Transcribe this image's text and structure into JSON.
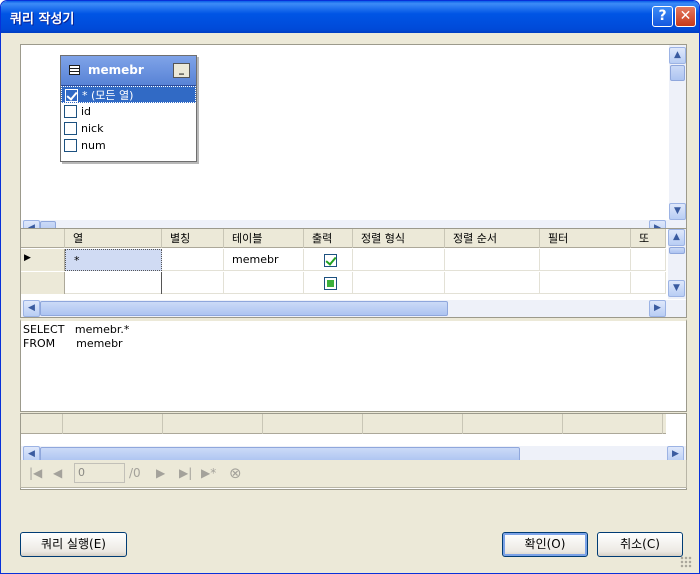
{
  "window": {
    "title": "쿼리 작성기",
    "help_label": "?",
    "close_label": "✕"
  },
  "diagram": {
    "table": {
      "name": "memebr",
      "minimize_label": "_",
      "columns": [
        {
          "label": "* (모든 열)",
          "checked": true,
          "selected": true
        },
        {
          "label": "id",
          "checked": false
        },
        {
          "label": "nick",
          "checked": false
        },
        {
          "label": "num",
          "checked": false
        }
      ]
    }
  },
  "grid": {
    "headers": [
      "열",
      "별칭",
      "테이블",
      "출력",
      "정렬 형식",
      "정렬 순서",
      "필터",
      "또는..."
    ],
    "rows": [
      {
        "marker": "▶",
        "column": "*",
        "alias": "",
        "table": "memebr",
        "output": "checked"
      },
      {
        "marker": "",
        "column": "",
        "alias": "",
        "table": "",
        "output": "indeterminate"
      }
    ]
  },
  "sql": {
    "text": "SELECT   memebr.*\nFROM      memebr"
  },
  "navigation": {
    "first_label": "|◀",
    "prev_label": "◀",
    "record_value": "0",
    "total_label": "/0",
    "next_label": "▶",
    "last_label": "▶|",
    "new_label": "▶*",
    "stop_label": "⊗"
  },
  "buttons": {
    "execute": "쿼리 실행(E)",
    "ok": "확인(O)",
    "cancel": "취소(C)"
  },
  "colors": {
    "titlebar": "#0055e5",
    "selection": "#316ac5",
    "dialog_bg": "#ece9d8"
  }
}
